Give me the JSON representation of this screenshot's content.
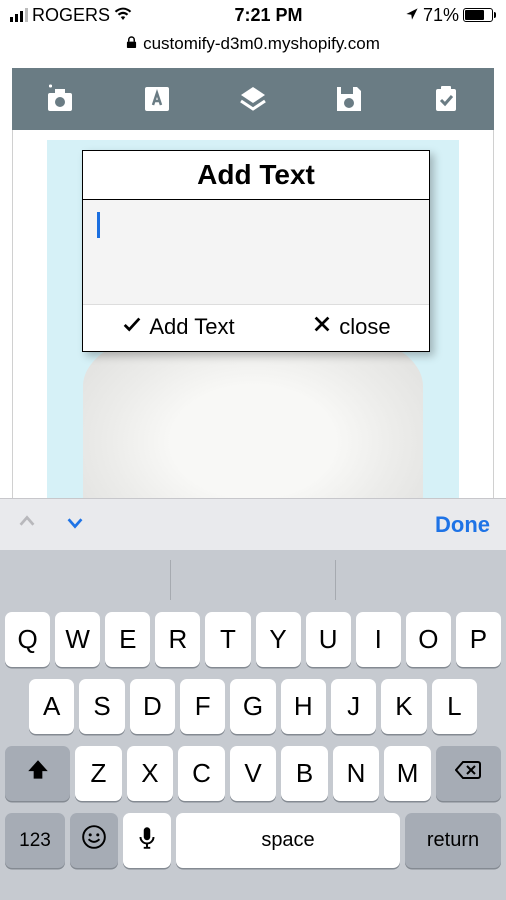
{
  "status": {
    "carrier": "ROGERS",
    "time": "7:21 PM",
    "battery_pct": "71%"
  },
  "url": "customify-d3m0.myshopify.com",
  "toolbar_icons": [
    "add-image-icon",
    "text-icon",
    "layers-icon",
    "save-icon",
    "clipboard-icon"
  ],
  "modal": {
    "title": "Add Text",
    "input_value": "",
    "add_label": "Add Text",
    "close_label": "close"
  },
  "kb_accessory": {
    "done": "Done"
  },
  "keyboard": {
    "row1": [
      "Q",
      "W",
      "E",
      "R",
      "T",
      "Y",
      "U",
      "I",
      "O",
      "P"
    ],
    "row2": [
      "A",
      "S",
      "D",
      "F",
      "G",
      "H",
      "J",
      "K",
      "L"
    ],
    "row3": [
      "Z",
      "X",
      "C",
      "V",
      "B",
      "N",
      "M"
    ],
    "num_key": "123",
    "space": "space",
    "return": "return"
  }
}
